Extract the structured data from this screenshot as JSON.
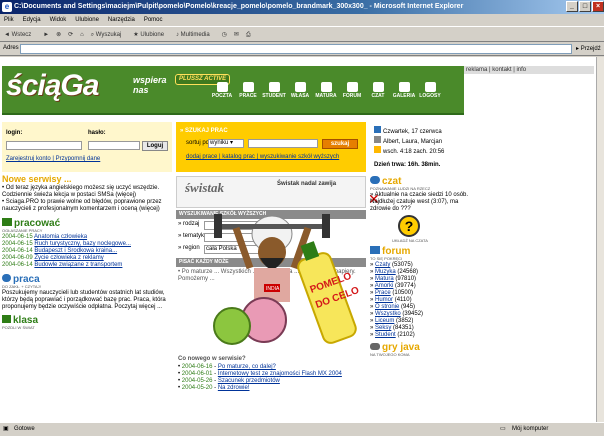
{
  "window": {
    "title": "C:\\Documents and Settings\\maciejm\\Pulpit\\pomelo\\Pomelo\\kreacje_pomelo\\pomelo_brandmark_300x300_ - Microsoft Internet Explorer",
    "close_label": "Zamknij"
  },
  "menubar": {
    "items": [
      "Plik",
      "Edycja",
      "Widok",
      "Ulubione",
      "Narzędzia",
      "Pomoc"
    ]
  },
  "toolbar": {
    "items": [
      "Wstecz",
      "Wyszukaj",
      "Ulubione",
      "Multimedia"
    ]
  },
  "addressbar": {
    "label": "Adres",
    "value": "",
    "go_label": "Przejdź"
  },
  "statusbar": {
    "left": "Gotowe",
    "right": "Mój komputer"
  },
  "site": {
    "topbar_left": "sciaga",
    "topbar_right": "reklama | kontakt | info",
    "brand": "ściąGa",
    "tagline": "wspiera nas",
    "tagline_badge": "PLUSSZ ACTIVE",
    "nav": [
      "POCZTA",
      "PRACE",
      "STUDENT",
      "WŁASA",
      "MATURA",
      "FORUM",
      "CZAT",
      "GALERIA",
      "LOGOSY"
    ],
    "login": {
      "login_label": "login:",
      "password_label": "hasło:",
      "button": "Loguj",
      "links": "Zarejestruj konto | Przypomnij dane"
    },
    "search": {
      "heading": "» SZUKAJ PRAC",
      "sort_label": "sortuj po",
      "sort_value": "wyniku",
      "button": "szukaj",
      "links": "dodaj prace | katalog prac | wyszukiwanie szkół wyższych"
    },
    "datebox": {
      "date": "Czwartek, 17 czerwca",
      "names": "Albert, Laura, Marcjan",
      "sunrise": "wsch. 4:18 zach. 20:56",
      "daylen": "Dzień trwa: 16h. 38min."
    },
    "news": {
      "title": "Nowe serwisy ...",
      "p1": "• Od teraz języka angielskiego możesz się uczyć wszędzie. Codziennie świeża lekcja w postaci SMSa (więcej)",
      "p2": "• Sciaga.PRO to prawie wolne od błędów, poprawione przez nauczycieli z profesjonalnym komentarzem i oceną (więcej)"
    },
    "pracowac": {
      "title": "pracować",
      "subtitle": "OGŁASZANIE PRACY",
      "items": [
        {
          "date": "2004-06-15",
          "text": "Anatomia człowieka"
        },
        {
          "date": "2004-06-15",
          "text": "Ruch turystyczny, bazy noclegowe..."
        },
        {
          "date": "2004-06-14",
          "text": "Budapeszt i Środkowa kraina..."
        },
        {
          "date": "2004-06-09",
          "text": "Życie człowieka z reklamy"
        },
        {
          "date": "2004-06-14",
          "text": "Budowle związane z transportem"
        }
      ]
    },
    "praca": {
      "title": "praca",
      "subtitle": "DO ZAKŁ. + CZYTAJ!",
      "text": "Poszukujemy nauczycieli lub studentów ostatnich lat studiów, którzy będą poprawiać i porządkować bazę prac. Praca, która proponujemy będzie oczywiście odpłatna. Poczytaj więcej ...",
      "bold": "odpłatna"
    },
    "klasa": {
      "title": "klasa",
      "subtitle": "POZDLI W ŚWIAT"
    },
    "middle": {
      "swistak_heading": "Świstak nadal zawija",
      "swistak_logo": "świstak",
      "wyszukiwanie": "WYSZUKIWANIE SZKÓŁ WYŻSZYCH",
      "rodzaj_label": "rodzaj",
      "tematyka_label": "tematyka",
      "region_label": "region",
      "region_value": "cała Polska",
      "pisac_heading": "PISAĆ KAŻDY MOŻE",
      "pisac_text": "• Po maturze ... Wszystkich ... skorzystania ... Nie wiesz ... papiery. Pomożemy ...",
      "new_heading": "Co nowego w serwisie?",
      "new_items": [
        {
          "date": "2004-06-16",
          "text": "Po maturze, co dalej?"
        },
        {
          "date": "2004-06-01",
          "text": "Internetowy test ze znajomości Flash MX 2004"
        },
        {
          "date": "2004-05-26",
          "text": "Szacunek przedmiotów"
        },
        {
          "date": "2004-05-20",
          "text": "Na zdrowie!"
        }
      ],
      "promo_line1": "POMELO",
      "promo_line2": "DO CELO",
      "promo_flag": "INDIA"
    },
    "czat": {
      "title": "czat",
      "subtitle": "POZNAWANIE LUDZI NA RZECZ",
      "text": "» Aktualnie na czacie siedzi 10 osób. Najdłużej czatuje west (3:07), ma zdrowie do ???",
      "count": "10",
      "user": "west (3:07)",
      "icon_caption": "UKŁADŹ NA CZATA"
    },
    "forum": {
      "title": "forum",
      "subtitle": "TO SIĘ POKRĘCI",
      "items": [
        {
          "name": "Czaty",
          "count": "(53075)"
        },
        {
          "name": "Muzyka",
          "count": "(24568)"
        },
        {
          "name": "Matura",
          "count": "(97810)"
        },
        {
          "name": "Amorki",
          "count": "(39774)"
        },
        {
          "name": "Prace",
          "count": "(10500)"
        },
        {
          "name": "Humor",
          "count": "(4110)"
        },
        {
          "name": "O stronie",
          "count": "(945)"
        },
        {
          "name": "Wszystko",
          "count": "(39452)"
        },
        {
          "name": "Liceum",
          "count": "(3852)"
        },
        {
          "name": "Seksy",
          "count": "(84351)"
        },
        {
          "name": "Student",
          "count": "(2102)"
        }
      ]
    },
    "gry": {
      "title": "gry java",
      "subtitle": "NA TWOJEGO KOMA"
    }
  }
}
